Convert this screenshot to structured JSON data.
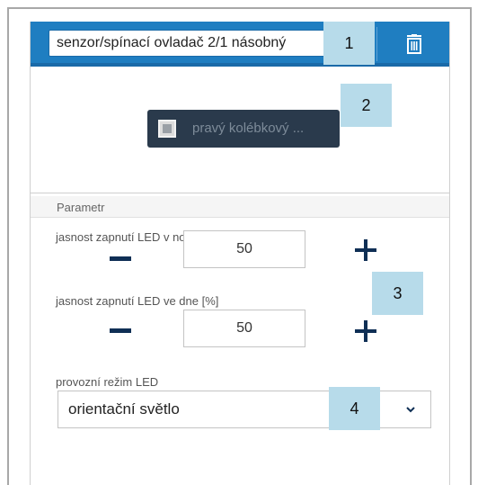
{
  "header": {
    "device_name": "senzor/spínací ovladač 2/1 násobný"
  },
  "rocker": {
    "label": "pravý kolébkový ..."
  },
  "section": {
    "title": "Parametr"
  },
  "params": [
    {
      "label": "jasnost zapnutí LED v noci [%]",
      "value": "50"
    },
    {
      "label": "jasnost zapnutí LED ve dne [%]",
      "value": "50"
    }
  ],
  "led_mode": {
    "label": "provozní režim LED",
    "selected": "orientační světlo"
  },
  "callouts": [
    "1",
    "2",
    "3",
    "4"
  ],
  "colors": {
    "header": "#1f7ec1",
    "rocker_bg": "#2a3a4c",
    "callout": "#b7dbea",
    "stepper": "#0f2f55"
  },
  "icons": {
    "delete": "trash-icon",
    "rocker": "rocker-square-icon",
    "dropdown": "chevron-down-icon",
    "decrement": "minus-icon",
    "increment": "plus-icon"
  }
}
